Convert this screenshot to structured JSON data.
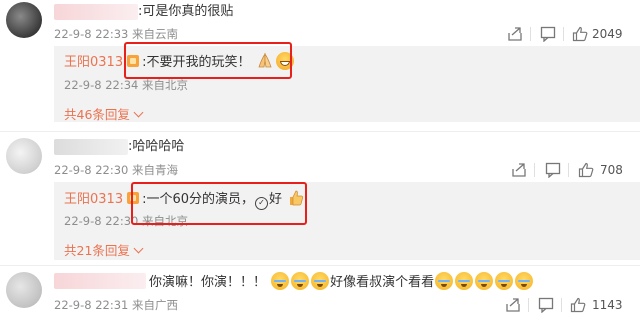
{
  "comments": [
    {
      "text": ":可是你真的很贴",
      "date": "22-9-8 22:33",
      "location": "来自云南",
      "likes": "2049",
      "reply": {
        "username": "王阳0313",
        "text": ":不要开我的玩笑！",
        "date": "22-9-8 22:34",
        "location": "来自北京"
      },
      "more_replies": "共46条回复"
    },
    {
      "text": ":哈哈哈哈",
      "date": "22-9-8 22:30",
      "location": "来自青海",
      "likes": "708",
      "reply": {
        "username": "王阳0313",
        "text": ":一个60分的演员，",
        "text_after": "好",
        "date": "22-9-8 22:30",
        "location": "来自北京"
      },
      "more_replies": "共21条回复"
    },
    {
      "text": "你演嘛！你演！！！",
      "text_after": "好像看叔演个看看",
      "date": "22-9-8 22:31",
      "location": "来自广西",
      "likes": "1143"
    }
  ],
  "icons": [
    "share-icon",
    "comment-icon",
    "like-icon",
    "ok-hand-icon",
    "grin-emoji",
    "praying-hands-emoji",
    "thumbs-up-emoji",
    "crying-emoji",
    "vip-badge-icon"
  ],
  "colors": {
    "username": "#eb7350",
    "highlight": "#e8201c",
    "meta": "#8d8d8d",
    "reply_bg": "#f2f2f2"
  }
}
